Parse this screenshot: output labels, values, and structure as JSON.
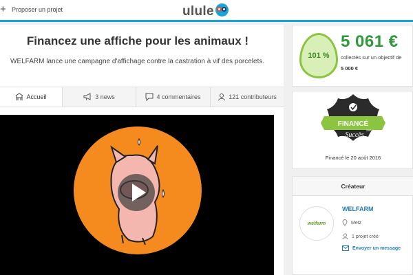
{
  "topbar": {
    "plus_icon": "plus-icon",
    "propose_label": "Proposer un projet",
    "brand": "ulule",
    "brand_colors": {
      "accent": "#18a5d6"
    }
  },
  "project": {
    "title": "Financez une affiche pour les animaux !",
    "subtitle": "WELFARM lance une campagne d'affichage contre la castration à vif des porcelets."
  },
  "tabs": [
    {
      "label": "Accueil",
      "icon": "home-icon",
      "active": true
    },
    {
      "label": "3 news",
      "icon": "megaphone-icon",
      "active": false
    },
    {
      "label": "4 commentaires",
      "icon": "comment-icon",
      "active": false
    },
    {
      "label": "121 contributeurs",
      "icon": "user-icon",
      "active": false
    }
  ],
  "video": {
    "play_icon": "play-icon"
  },
  "funding": {
    "percent": "101 %",
    "amount": "5 061 €",
    "collected_text": "collectés sur un objectif de",
    "goal": "5 000 €",
    "colors": {
      "amount": "#2f9a3c",
      "egg_border": "#8bc53f"
    }
  },
  "badge": {
    "ribbon": "FINANCÉ",
    "connector": "avec",
    "word": "Succès",
    "date_text": "Financé le 20 août 2016"
  },
  "creator": {
    "header": "Créateur",
    "avatar_text": "welfarm",
    "name": "WELFARM",
    "city": "Metz",
    "projects": "1 projet créé",
    "message_link": "Envoyer un message"
  }
}
